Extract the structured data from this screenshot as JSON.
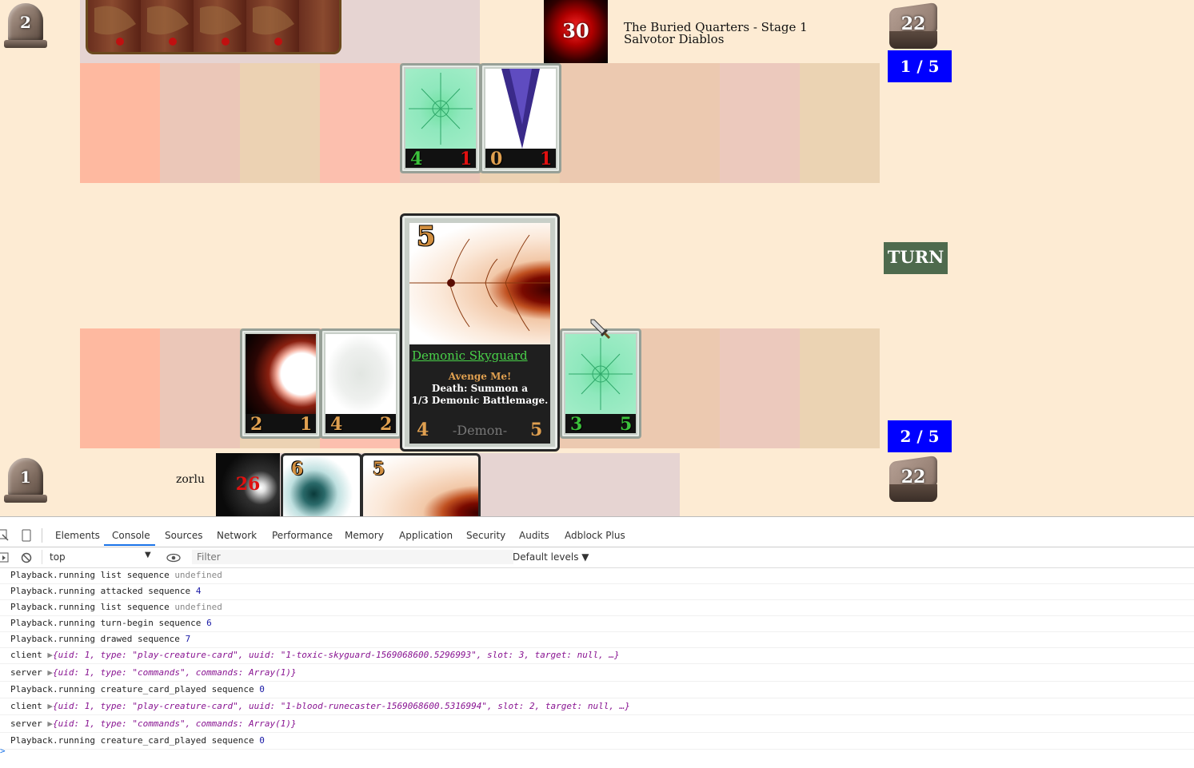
{
  "opponent": {
    "graveyard_count": "2",
    "portrait_hp": "30",
    "stage": "The Buried Quarters - Stage 1",
    "name": "Salvotor Diablos",
    "deck_count": "22",
    "mana": "1 / 5",
    "board": [
      {
        "attack": "4",
        "health": "1"
      },
      {
        "attack": "0",
        "health": "1"
      }
    ]
  },
  "turn_label": "TURN",
  "player": {
    "graveyard_count": "1",
    "name": "zorlu",
    "portrait_hp": "26",
    "deck_count": "22",
    "mana": "2 / 5",
    "board": [
      {
        "attack": "2",
        "health": "1"
      },
      {
        "attack": "4",
        "health": "2"
      },
      {
        "attack": "3",
        "health": "5"
      }
    ],
    "hand": [
      {
        "cost": "6"
      },
      {
        "cost": "5"
      }
    ]
  },
  "zoom_card": {
    "cost": "5",
    "name": "Demonic Skyguard",
    "ability_title": "Avenge Me!",
    "ability_line1": "Death: Summon a",
    "ability_line2": "1/3 Demonic Battlemage.",
    "attack": "4",
    "type": "-Demon-",
    "health": "5"
  },
  "devtools": {
    "tabs": [
      "Elements",
      "Console",
      "Sources",
      "Network",
      "Performance",
      "Memory",
      "Application",
      "Security",
      "Audits",
      "Adblock Plus"
    ],
    "active_tab": "Console",
    "context": "top",
    "filter_placeholder": "Filter",
    "levels": "Default levels ▼",
    "logs": [
      {
        "source": "Playback.running",
        "text": "list sequence",
        "value": "undefined"
      },
      {
        "source": "Playback.running",
        "text": "attacked sequence",
        "value": "4"
      },
      {
        "source": "Playback.running",
        "text": "list sequence",
        "value": "undefined"
      },
      {
        "source": "Playback.running",
        "text": "turn-begin sequence",
        "value": "6"
      },
      {
        "source": "Playback.running",
        "text": "drawed sequence",
        "value": "7"
      },
      {
        "source": "client",
        "obj": "{uid: 1, type: \"play-creature-card\", uuid: \"1-toxic-skyguard-1569068600.5296993\", slot: 3, target: null, …}"
      },
      {
        "source": "server",
        "obj": "{uid: 1, type: \"commands\", commands: Array(1)}"
      },
      {
        "source": "Playback.running",
        "text": "creature_card_played sequence",
        "value": "0"
      },
      {
        "source": "client",
        "obj": "{uid: 1, type: \"play-creature-card\", uuid: \"1-blood-runecaster-1569068600.5316994\", slot: 2, target: null, …}"
      },
      {
        "source": "server",
        "obj": "{uid: 1, type: \"commands\", commands: Array(1)}"
      },
      {
        "source": "Playback.running",
        "text": "creature_card_played sequence",
        "value": "0"
      }
    ],
    "prompt": ">"
  }
}
